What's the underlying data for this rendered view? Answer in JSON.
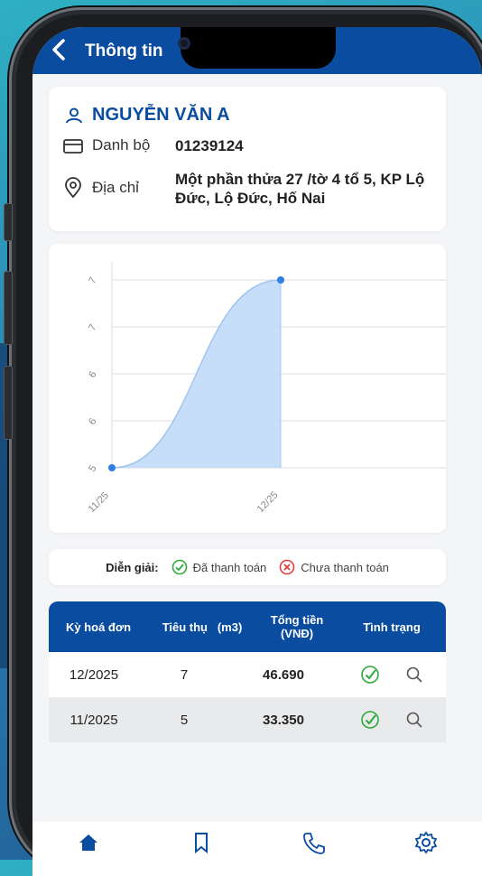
{
  "header": {
    "title": "Thông tin",
    "back_icon": "chevron-left-icon"
  },
  "customer": {
    "name": "NGUYỄN VĂN A",
    "danh_bo_label": "Danh bộ",
    "danh_bo_value": "01239124",
    "dia_chi_label": "Địa chỉ",
    "dia_chi_value": "Một phần thửa 27 /tờ 4 tổ 5, KP Lộ Đức, Lộ Đức, Hố Nai"
  },
  "chart_data": {
    "type": "area",
    "x": [
      "11/25",
      "12/25"
    ],
    "y": [
      5,
      7
    ],
    "y_tick_labels": [
      "5",
      "6",
      "6",
      "7",
      "7"
    ],
    "ylim": [
      5,
      7
    ],
    "grid": true,
    "color": "#2f7fe0"
  },
  "legend": {
    "title": "Diễn giải:",
    "paid": "Đã thanh toán",
    "unpaid": "Chưa thanh toán",
    "paid_color": "#2eaa3c",
    "unpaid_color": "#e23b3b"
  },
  "table": {
    "headers": [
      "Kỳ hoá đơn",
      "Tiêu thụ   (m3)",
      "Tổng tiền (VNĐ)",
      "Tình trạng"
    ],
    "rows": [
      {
        "period": "12/2025",
        "usage": "7",
        "total": "46.690"
      },
      {
        "period": "11/2025",
        "usage": "5",
        "total": "33.350"
      }
    ]
  },
  "nav": [
    "home-icon",
    "bookmark-icon",
    "phone-icon",
    "gear-icon"
  ],
  "colors": {
    "primary": "#0a4c9f"
  }
}
